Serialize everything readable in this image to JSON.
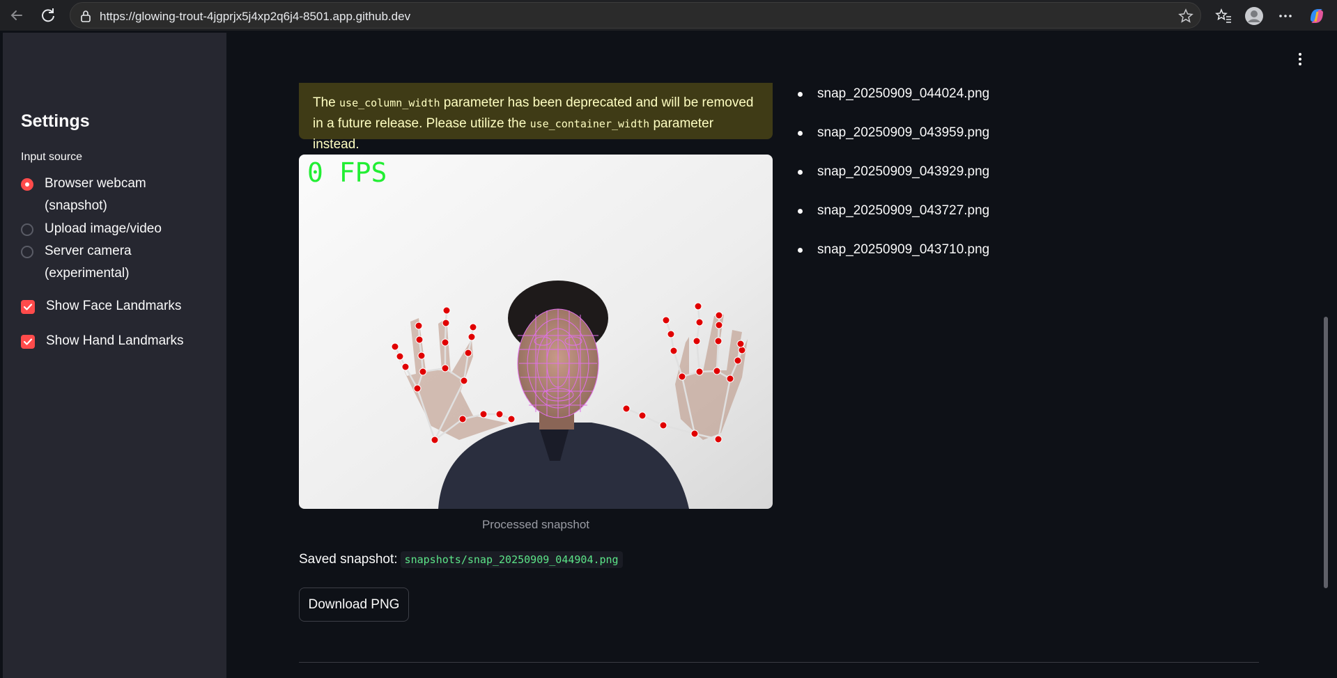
{
  "browser": {
    "url": "https://glowing-trout-4jgprjx5j4xp2q6j4-8501.app.github.dev"
  },
  "sidebar": {
    "title": "Settings",
    "input_source_label": "Input source",
    "radio_options": [
      {
        "line1": "Browser webcam",
        "line2": "(snapshot)",
        "selected": true
      },
      {
        "line1": "Upload image/video",
        "line2": "",
        "selected": false
      },
      {
        "line1": "Server camera",
        "line2": "(experimental)",
        "selected": false
      }
    ],
    "checkboxes": [
      {
        "label": "Show Face Landmarks",
        "checked": true
      },
      {
        "label": "Show Hand Landmarks",
        "checked": true
      }
    ]
  },
  "main": {
    "warning": {
      "part1": "The ",
      "code1": "use_column_width",
      "part2": " parameter has been deprecated and will be removed in a future release. Please utilize the ",
      "code2": "use_container_width",
      "part3": " parameter instead."
    },
    "snapshot": {
      "fps_text": "0 FPS",
      "caption": "Processed snapshot"
    },
    "saved": {
      "label": "Saved snapshot:",
      "path": "snapshots/snap_20250909_044904.png"
    },
    "download_label": "Download PNG",
    "snapshot_files": [
      "snap_20250909_044024.png",
      "snap_20250909_043959.png",
      "snap_20250909_043929.png",
      "snap_20250909_043727.png",
      "snap_20250909_043710.png"
    ]
  },
  "colors": {
    "accent": "#ff4b4b",
    "sidebar_bg": "#262730",
    "main_bg": "#0e1117",
    "warning_bg": "#3f3b16",
    "fps_green": "#22ee33",
    "landmark_red": "#e00000",
    "face_mesh": "#e070e8"
  }
}
